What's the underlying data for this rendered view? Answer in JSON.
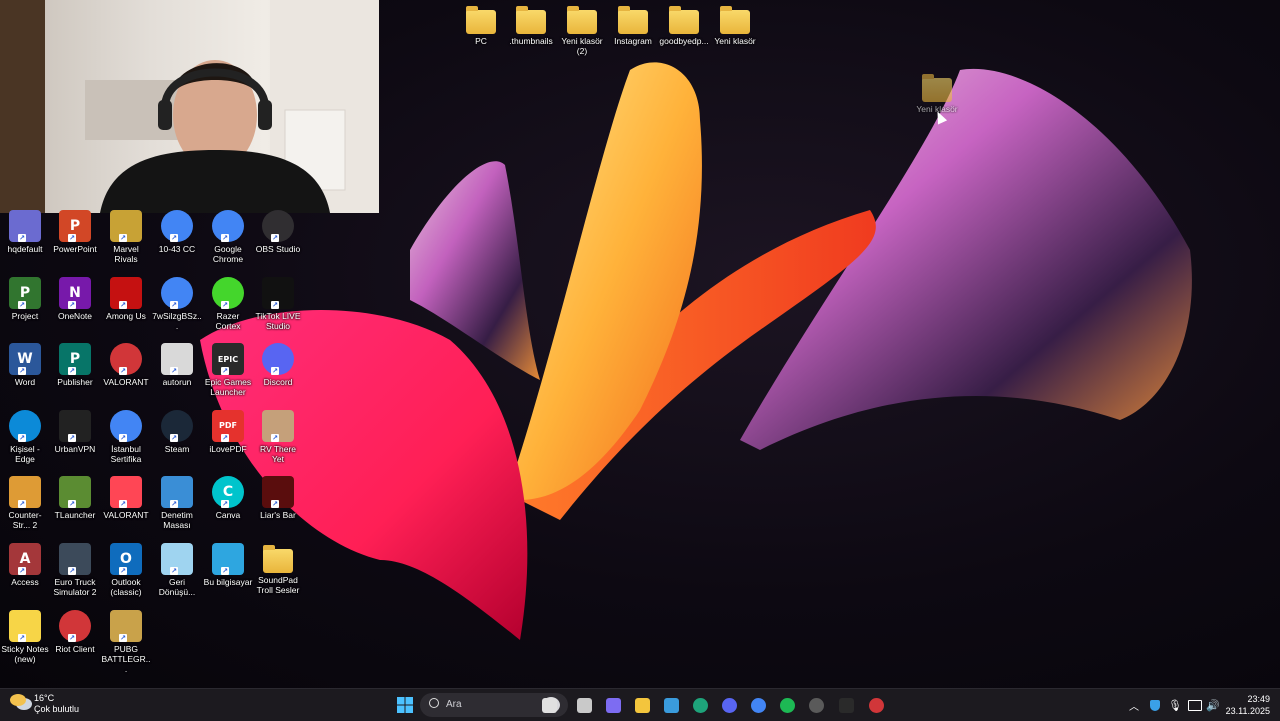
{
  "desktop_icons": {
    "top_row": [
      {
        "label": "PC",
        "icon": "folder-icon"
      },
      {
        "label": ".thumbnails",
        "icon": "folder-icon"
      },
      {
        "label": "Yeni klasör (2)",
        "icon": "folder-icon"
      },
      {
        "label": "Instagram",
        "icon": "folder-icon"
      },
      {
        "label": "goodbyedp...",
        "icon": "folder-icon"
      },
      {
        "label": "Yeni klasör",
        "icon": "folder-icon"
      }
    ],
    "dragged": {
      "label": "Yeni klasör",
      "icon": "folder-icon"
    },
    "grid": [
      {
        "label": "hqdefault",
        "icon": "image-icon",
        "color": "#6b6bd0"
      },
      {
        "label": "PowerPoint",
        "icon": "powerpoint-icon",
        "color": "#d24726"
      },
      {
        "label": "Marvel Rivals",
        "icon": "marvel-rivals-icon",
        "color": "#c8a235"
      },
      {
        "label": "10-43 CC",
        "icon": "chrome-icon",
        "color": "#4285f4"
      },
      {
        "label": "Google Chrome",
        "icon": "chrome-icon",
        "color": "#4285f4"
      },
      {
        "label": "OBS Studio",
        "icon": "obs-icon",
        "color": "#302e31"
      },
      {
        "label": "Project",
        "icon": "project-icon",
        "color": "#31752f"
      },
      {
        "label": "OneNote",
        "icon": "onenote-icon",
        "color": "#7719aa"
      },
      {
        "label": "Among Us",
        "icon": "among-us-icon",
        "color": "#c51111"
      },
      {
        "label": "7wSilzgBSz...",
        "icon": "chrome-icon",
        "color": "#4285f4"
      },
      {
        "label": "Razer Cortex",
        "icon": "razer-icon",
        "color": "#44d62c"
      },
      {
        "label": "TikTok LIVE Studio",
        "icon": "tiktok-icon",
        "color": "#111111"
      },
      {
        "label": "Word",
        "icon": "word-icon",
        "color": "#2b579a"
      },
      {
        "label": "Publisher",
        "icon": "publisher-icon",
        "color": "#077568"
      },
      {
        "label": "VALORANT",
        "icon": "riot-icon",
        "color": "#d13639"
      },
      {
        "label": "autorun",
        "icon": "file-icon",
        "color": "#d9d9d9"
      },
      {
        "label": "Epic Games Launcher",
        "icon": "epic-games-icon",
        "color": "#2a2a2a"
      },
      {
        "label": "Discord",
        "icon": "discord-icon",
        "color": "#5865f2"
      },
      {
        "label": "Kişisel - Edge",
        "icon": "edge-icon",
        "color": "#0c8ad8"
      },
      {
        "label": "UrbanVPN",
        "icon": "vpn-icon",
        "color": "#222222"
      },
      {
        "label": "İstanbul Sertifika",
        "icon": "chrome-icon",
        "color": "#4285f4"
      },
      {
        "label": "Steam",
        "icon": "steam-icon",
        "color": "#1b2838"
      },
      {
        "label": "iLovePDF",
        "icon": "pdf-icon",
        "color": "#e5322d"
      },
      {
        "label": "RV There Yet",
        "icon": "game-icon",
        "color": "#c5a07a"
      },
      {
        "label": "Counter-Str... 2",
        "icon": "cs2-icon",
        "color": "#de9b35"
      },
      {
        "label": "TLauncher",
        "icon": "minecraft-icon",
        "color": "#5b8c32"
      },
      {
        "label": "VALORANT",
        "icon": "valorant-icon",
        "color": "#ff4655"
      },
      {
        "label": "Denetim Masası",
        "icon": "control-panel-icon",
        "color": "#3a8ed6"
      },
      {
        "label": "Canva",
        "icon": "canva-icon",
        "color": "#00c4cc"
      },
      {
        "label": "Liar's Bar",
        "icon": "liars-bar-icon",
        "color": "#5a0d0d"
      },
      {
        "label": "Access",
        "icon": "access-icon",
        "color": "#a4373a"
      },
      {
        "label": "Euro Truck Simulator 2",
        "icon": "truck-icon",
        "color": "#3c4a5a"
      },
      {
        "label": "Outlook (classic)",
        "icon": "outlook-icon",
        "color": "#0f6cbd"
      },
      {
        "label": "Geri Dönüşü...",
        "icon": "recycle-bin-icon",
        "color": "#9fd4f0"
      },
      {
        "label": "Bu bilgisayar",
        "icon": "computer-icon",
        "color": "#2ea6e0"
      },
      {
        "label": "SoundPad Troll Sesler",
        "icon": "folder-icon",
        "color": "#e9b53b"
      },
      {
        "label": "Sticky Notes (new)",
        "icon": "sticky-notes-icon",
        "color": "#f7d547"
      },
      {
        "label": "Riot Client",
        "icon": "riot-icon",
        "color": "#d13639"
      },
      {
        "label": "PUBG BATTLEGR...",
        "icon": "pubg-icon",
        "color": "#c9a24a"
      }
    ]
  },
  "taskbar": {
    "weather_temp": "16°C",
    "weather_desc": "Çok bulutlu",
    "search_placeholder": "Ara",
    "apps": [
      "start-icon",
      "search-icon",
      "copilot-icon",
      "task-view-icon",
      "ai-icon",
      "file-explorer-icon",
      "store-icon",
      "edge-icon",
      "discord-icon",
      "chrome-icon",
      "spotify-icon",
      "obs-icon",
      "game-icon",
      "riot-icon"
    ],
    "time": "23:49",
    "date": "23.11.2025"
  },
  "colors": {
    "taskbar_bg": "#1c1a1f",
    "accent": "#0078d4"
  }
}
